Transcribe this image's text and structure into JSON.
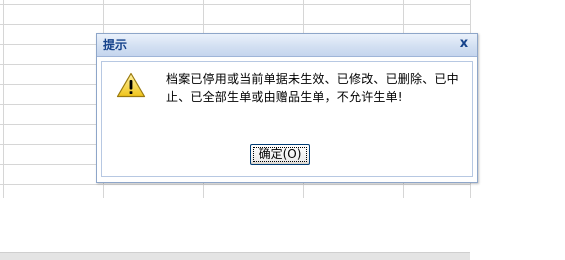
{
  "dialog": {
    "title": "提示",
    "close_glyph": "x",
    "message": "档案已停用或当前单据未生效、已修改、已删除、已中止、已全部生单或由赠品生单，不允许生单!",
    "icon": "warning-icon",
    "ok_label": "确定(O)"
  },
  "colors": {
    "title_text": "#15428b",
    "titlebar_top": "#eaf1fb",
    "titlebar_bottom": "#c5d5ee",
    "warning_yellow": "#f7d94c",
    "button_border": "#003c74"
  }
}
